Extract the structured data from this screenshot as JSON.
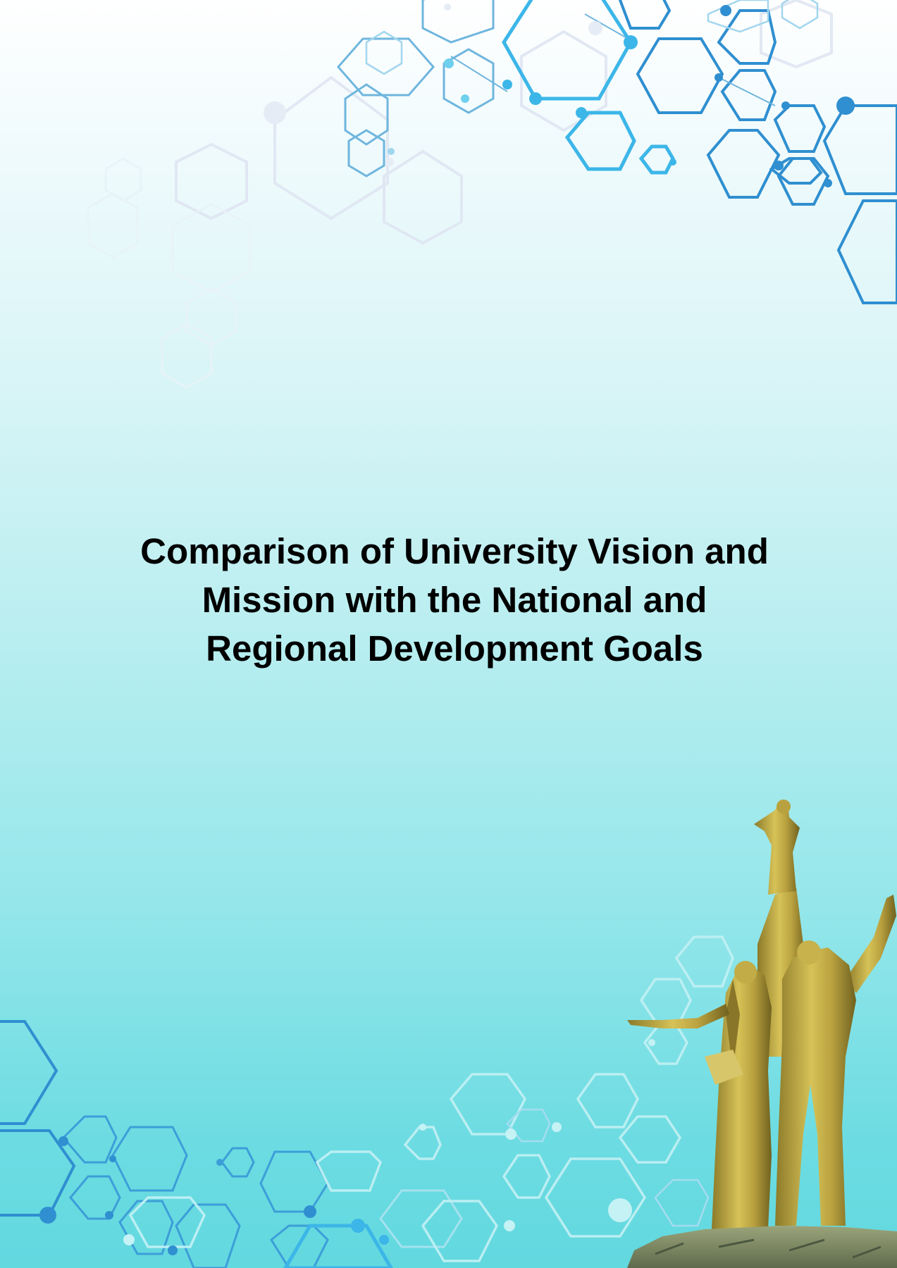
{
  "document": {
    "title_lines": [
      "Comparison of University Vision and",
      "Mission with the National and",
      "Regional Development Goals"
    ]
  },
  "decor": {
    "accent": "#2f8fd0",
    "accent_light": "#3cc3ec",
    "statue_gold": "#c9b04a",
    "statue_shadow": "#7a6a24",
    "icons": [
      "hexagon-network-top-icon",
      "hexagon-network-bottom-icon",
      "monument-statue-icon"
    ]
  }
}
